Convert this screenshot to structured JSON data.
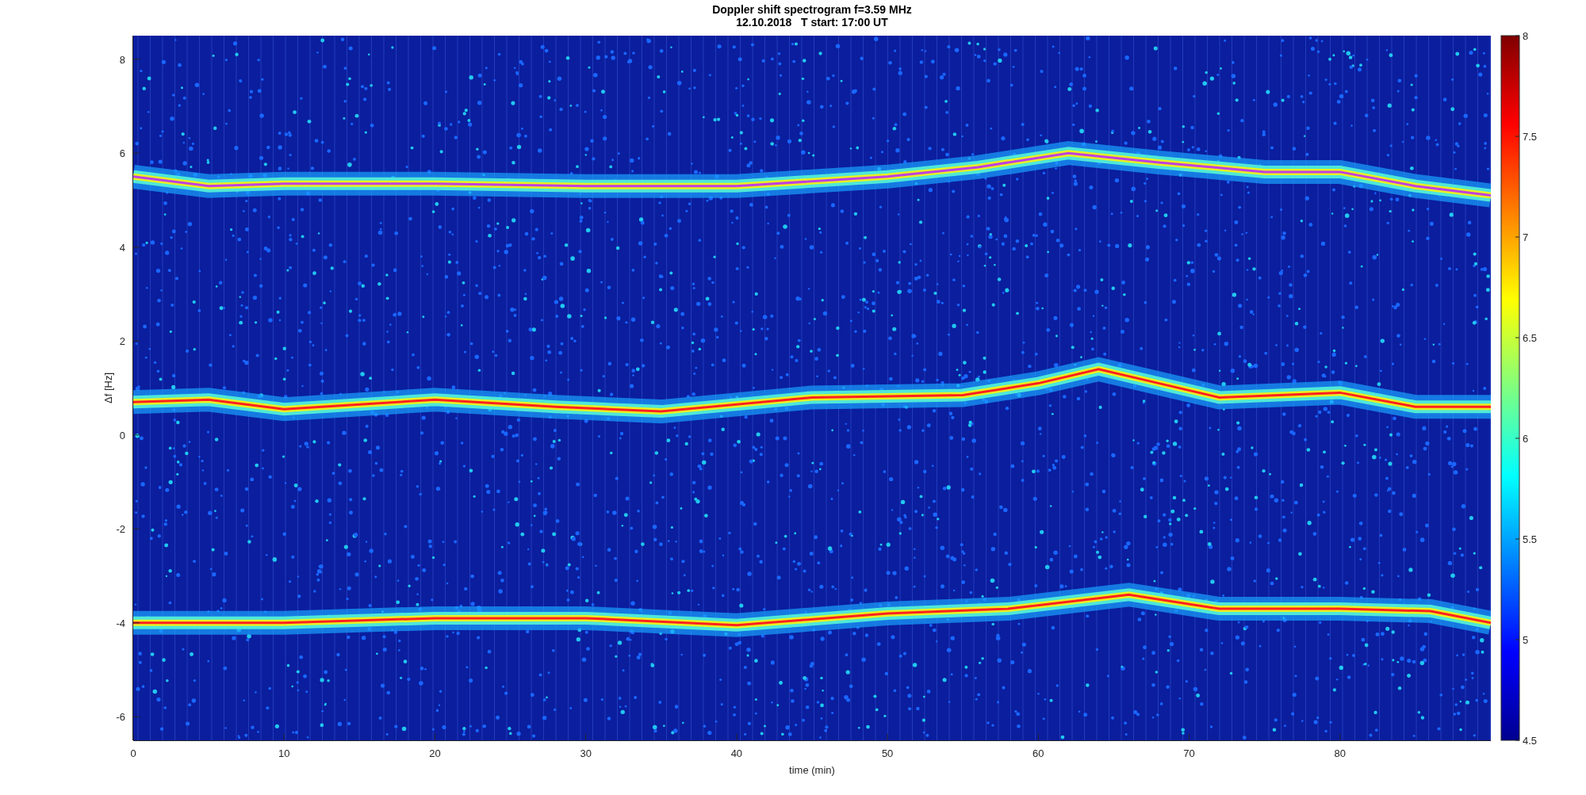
{
  "figure": {
    "title": [
      "Doppler shift spectrogram f=3.59 MHz",
      "12.10.2018   T start: 17:00 UT"
    ],
    "axes": {
      "xlabel": "time (min)",
      "ylabel": "Δf [Hz]",
      "xticks": [
        "0",
        "10",
        "20",
        "30",
        "40",
        "50",
        "60",
        "70",
        "80"
      ],
      "yticks": [
        "8",
        "6",
        "4",
        "2",
        "0",
        "-2",
        "-4",
        "-6"
      ]
    },
    "colorbar": {
      "ticks": [
        "8",
        "7.5",
        "7",
        "6.5",
        "6",
        "5.5",
        "5",
        "4.5"
      ]
    }
  }
}
